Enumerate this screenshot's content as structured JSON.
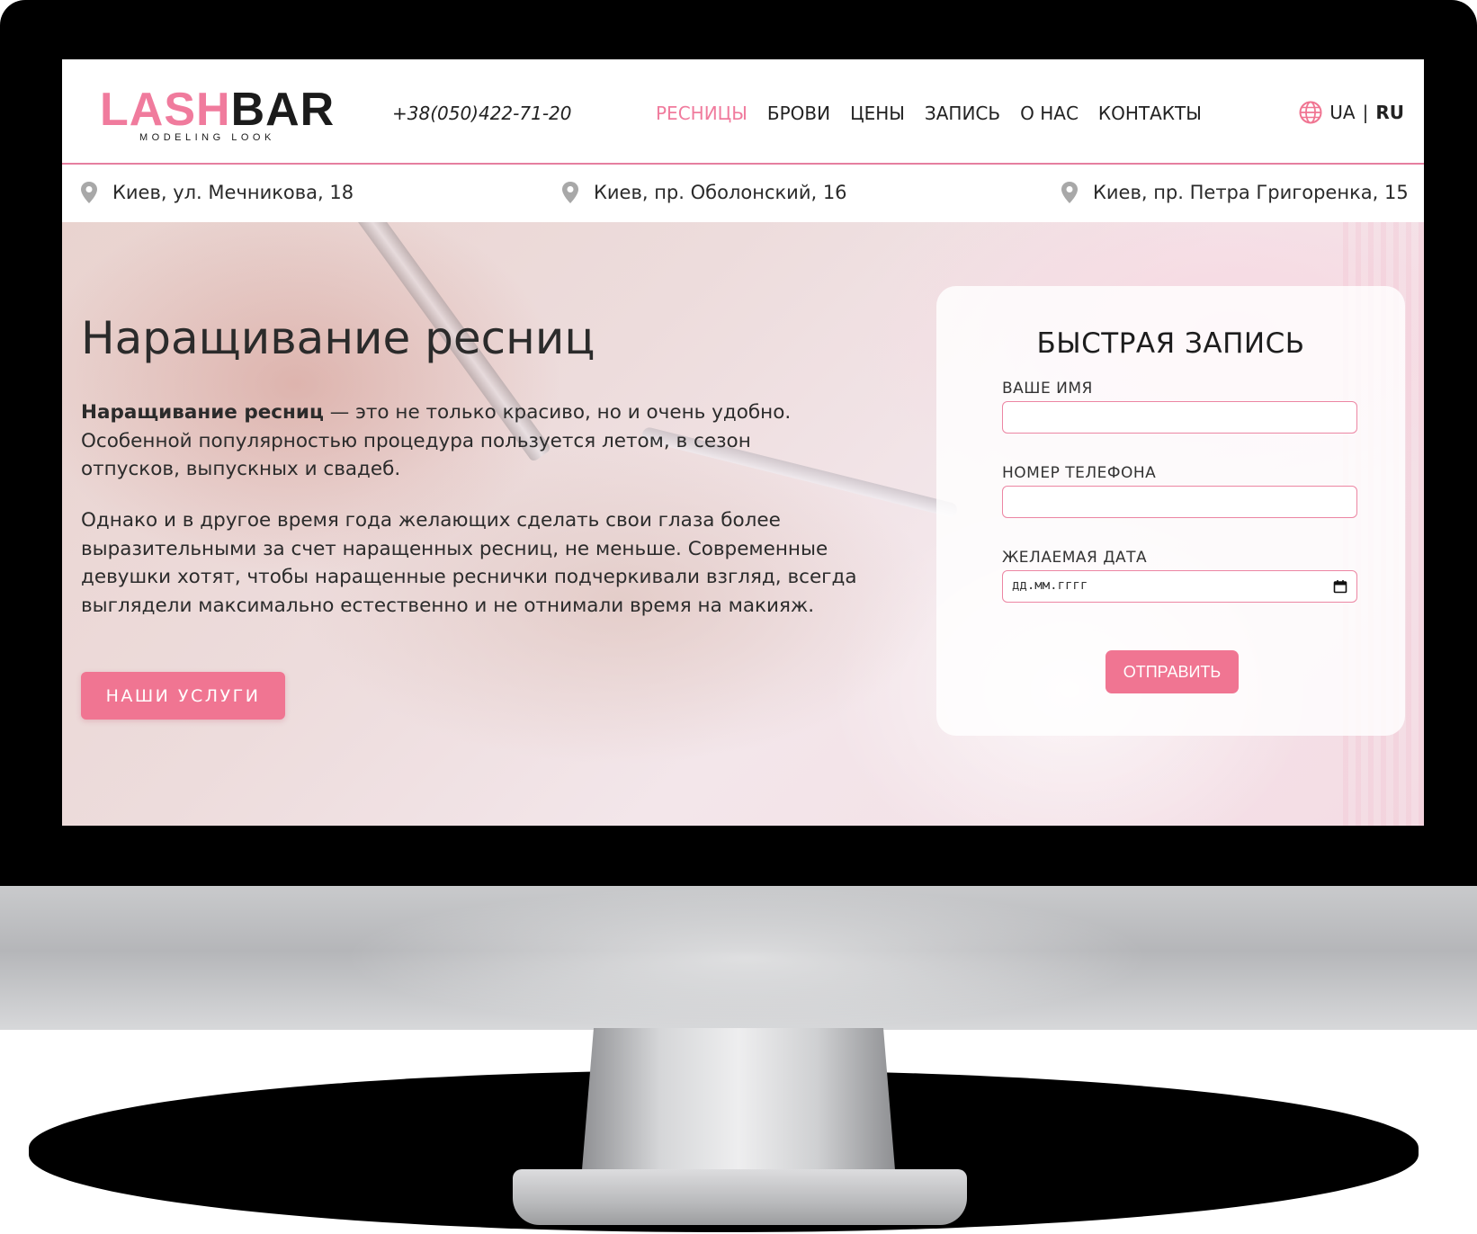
{
  "header": {
    "logo": {
      "lash": "LASH",
      "bar": "BAR",
      "tagline": "MODELING LOOK"
    },
    "phone": "+38(050)422-71-20",
    "nav": [
      {
        "label": "РЕСНИЦЫ",
        "active": true
      },
      {
        "label": "БРОВИ",
        "active": false
      },
      {
        "label": "ЦЕНЫ",
        "active": false
      },
      {
        "label": "ЗАПИСЬ",
        "active": false
      },
      {
        "label": "О НАС",
        "active": false
      },
      {
        "label": "КОНТАКТЫ",
        "active": false
      }
    ],
    "languages": {
      "ua": "UA",
      "separator": "|",
      "ru": "RU",
      "current": "RU"
    }
  },
  "addresses": [
    "Киев, ул. Мечникова, 18",
    "Киев, пр. Оболонский, 16",
    "Киев, пр. Петра Григоренка, 15"
  ],
  "hero": {
    "title": "Наращивание ресниц",
    "p1_bold": "Наращивание ресниц",
    "p1_rest": " — это не только красиво, но и очень удобно. Особенной популярностью процедура пользуется летом, в сезон отпусков, выпускных и свадеб.",
    "p2": "Однако и в другое время года желающих сделать свои глаза более выразительными за счет наращенных ресниц, не меньше. Современные девушки хотят, чтобы наращенные реснички подчеркивали взгляд, всегда выглядели максимально естественно и не отнимали время на макияж.",
    "button": "НАШИ УСЛУГИ"
  },
  "form": {
    "title": "БЫСТРАЯ ЗАПИСЬ",
    "name_label": "ВАШЕ ИМЯ",
    "name_value": "",
    "phone_label": "НОМЕР ТЕЛЕФОНА",
    "phone_value": "",
    "date_label": "ЖЕЛАЕМАЯ ДАТА",
    "date_placeholder": "дд.мм.гггг",
    "submit": "ОТПРАВИТЬ"
  },
  "colors": {
    "accent": "#f07592",
    "logo_pink": "#f07b9d",
    "divider": "#e67fa0",
    "text": "#2b2b2b"
  },
  "icons": [
    "globe-icon",
    "pin-icon",
    "calendar-icon"
  ]
}
